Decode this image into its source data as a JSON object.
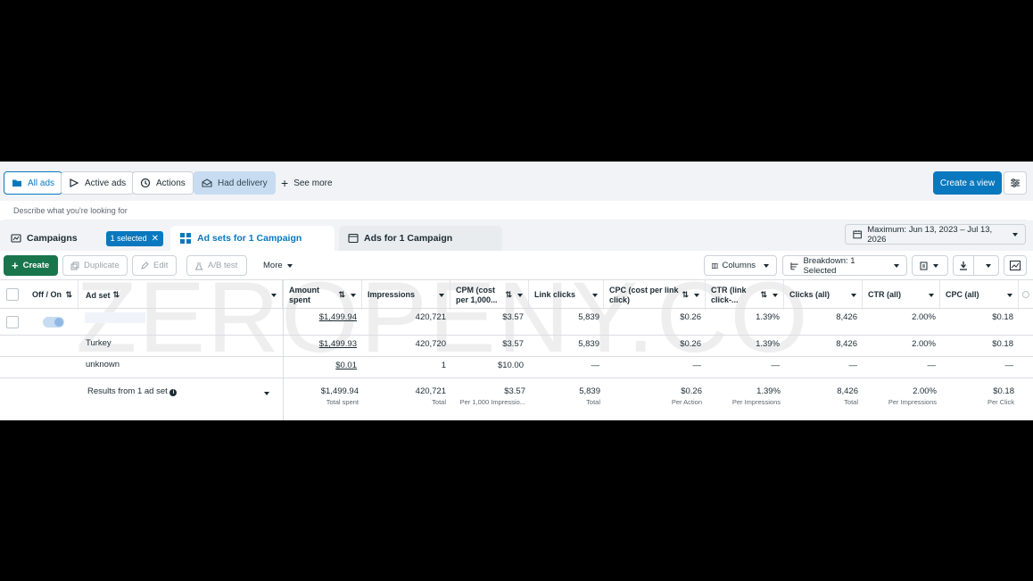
{
  "filters": {
    "all_ads": "All ads",
    "active_ads": "Active ads",
    "actions": "Actions",
    "had_delivery": "Had delivery",
    "see_more": "See more",
    "create_view": "Create a view"
  },
  "search": {
    "placeholder": "Describe what you're looking for"
  },
  "tabs": {
    "campaigns": "Campaigns",
    "selected_badge": "1 selected",
    "ad_sets": "Ad sets for 1 Campaign",
    "ads": "Ads for 1 Campaign",
    "date_range": "Maximum: Jun 13, 2023 – Jul 13, 2026"
  },
  "toolbar": {
    "create": "Create",
    "duplicate": "Duplicate",
    "edit": "Edit",
    "ab_test": "A/B test",
    "more": "More",
    "columns": "Columns",
    "breakdown": "Breakdown: 1 Selected"
  },
  "table": {
    "headers": {
      "off_on": "Off / On",
      "ad_set": "Ad set",
      "amount_spent": "Amount spent",
      "impressions": "Impressions",
      "cpm": "CPM (cost per 1,000...",
      "link_clicks": "Link clicks",
      "cpc_link": "CPC (cost per link click)",
      "ctr_link": "CTR (link click-...",
      "clicks_all": "Clicks (all)",
      "ctr_all": "CTR (all)",
      "cpc_all": "CPC (all)"
    },
    "rows": [
      {
        "name": "",
        "amount_spent": "$1,499.94",
        "impressions": "420,721",
        "cpm": "$3.57",
        "link_clicks": "5,839",
        "cpc_link": "$0.26",
        "ctr_link": "1.39%",
        "clicks_all": "8,426",
        "ctr_all": "2.00%",
        "cpc_all": "$0.18"
      },
      {
        "name": "Turkey",
        "amount_spent": "$1,499.93",
        "impressions": "420,720",
        "cpm": "$3.57",
        "link_clicks": "5,839",
        "cpc_link": "$0.26",
        "ctr_link": "1.39%",
        "clicks_all": "8,426",
        "ctr_all": "2.00%",
        "cpc_all": "$0.18"
      },
      {
        "name": "unknown",
        "amount_spent": "$0.01",
        "impressions": "1",
        "cpm": "$10.00",
        "link_clicks": "—",
        "cpc_link": "—",
        "ctr_link": "—",
        "clicks_all": "—",
        "ctr_all": "—",
        "cpc_all": "—"
      }
    ],
    "summary": {
      "label": "Results from 1 ad set",
      "amount_spent": "$1,499.94",
      "amount_spent_sub": "Total spent",
      "impressions": "420,721",
      "impressions_sub": "Total",
      "cpm": "$3.57",
      "cpm_sub": "Per 1,000 Impressio...",
      "link_clicks": "5,839",
      "link_clicks_sub": "Total",
      "cpc_link": "$0.26",
      "cpc_link_sub": "Per Action",
      "ctr_link": "1.39%",
      "ctr_link_sub": "Per Impressions",
      "clicks_all": "8,426",
      "clicks_all_sub": "Total",
      "ctr_all": "2.00%",
      "ctr_all_sub": "Per Impressions",
      "cpc_all": "$0.18",
      "cpc_all_sub": "Per Click"
    }
  },
  "watermark": "ZEROPENY.CO",
  "colors": {
    "accent": "#0a78be",
    "create_green": "#19764c",
    "delivery_chip": "#c7dcf1"
  },
  "icons": [
    "folder-icon",
    "play-outline-icon",
    "actions-icon",
    "delivery-icon",
    "plus-icon",
    "sliders-icon",
    "campaign-icon",
    "close-icon",
    "grid-icon",
    "ad-icon",
    "calendar-icon",
    "copy-icon",
    "pencil-icon",
    "flask-icon",
    "columns-icon",
    "breakdown-icon",
    "reports-icon",
    "download-icon",
    "chart-icon",
    "info-icon"
  ]
}
